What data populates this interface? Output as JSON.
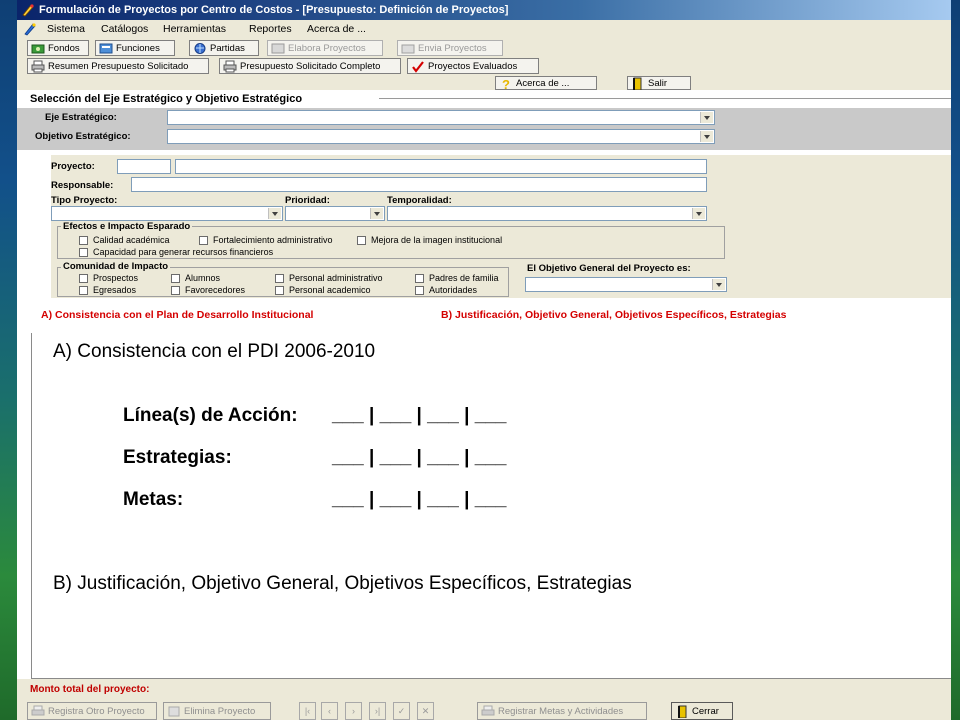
{
  "window": {
    "title": "Formulación de Proyectos por Centro de Costos - [Presupuesto: Definición de Proyectos]"
  },
  "menu": [
    "Sistema",
    "Catálogos",
    "Herramientas",
    "Reportes",
    "Acerca de ..."
  ],
  "toolbar": {
    "row1": [
      {
        "label": "Fondos",
        "icon": "fondos-icon",
        "enabled": true
      },
      {
        "label": "Funciones",
        "icon": "funciones-icon",
        "enabled": true
      },
      {
        "label": "Partidas",
        "icon": "partidas-icon",
        "enabled": true
      },
      {
        "label": "Elabora Proyectos",
        "icon": "elabora-icon",
        "enabled": false
      },
      {
        "label": "Envia Proyectos",
        "icon": "envia-icon",
        "enabled": false
      }
    ],
    "row2": [
      {
        "label": "Resumen Presupuesto Solicitado",
        "icon": "printer-icon",
        "enabled": true
      },
      {
        "label": "Presupuesto Solicitado Completo",
        "icon": "printer-icon",
        "enabled": true
      },
      {
        "label": "Proyectos Evaluados",
        "icon": "checkmark-icon",
        "enabled": true
      }
    ],
    "row3": [
      {
        "label": "Acerca de ...",
        "icon": "help-icon"
      },
      {
        "label": "Salir",
        "icon": "exit-door-icon"
      }
    ]
  },
  "selection": {
    "title": "Selección del Eje Estratégico y Objetivo Estratégico",
    "eje_label": "Eje Estratégico:",
    "eje_value": "",
    "objetivo_label": "Objetivo Estratégico:",
    "objetivo_value": ""
  },
  "project": {
    "proyecto_label": "Proyecto:",
    "responsable_label": "Responsable:",
    "tipo_label": "Tipo Proyecto:",
    "prioridad_label": "Prioridad:",
    "temporalidad_label": "Temporalidad:",
    "efectos_title": "Efectos e Impacto Esparado",
    "efectos": [
      "Calidad académica",
      "Fortalecimiento administrativo",
      "Mejora de la imagen institucional",
      "Capacidad para generar recursos financieros"
    ],
    "comunidad_title": "Comunidad de Impacto",
    "comunidad": [
      "Prospectos",
      "Alumnos",
      "Personal administrativo",
      "Padres de familia",
      "Egresados",
      "Favorecedores",
      "Personal academico",
      "Autoridades"
    ],
    "objetivo_general_label": "El Objetivo General del Proyecto es:"
  },
  "tabs": [
    "A)     Consistencia con el Plan de Desarrollo Institucional",
    "B) Justificación, Objetivo General, Objetivos Específicos, Estrategias"
  ],
  "content": {
    "heading_a": "A)  Consistencia con el PDI 2006-2010",
    "rows": [
      {
        "label": "Línea(s) de Acción:",
        "blanks": "___ | ___ | ___ | ___"
      },
      {
        "label": "Estrategias:",
        "blanks": "___ | ___ | ___ | ___"
      },
      {
        "label": "Metas:",
        "blanks": "___ | ___ | ___ | ___"
      }
    ],
    "heading_b": "B)  Justificación, Objetivo General, Objetivos Específicos, Estrategias"
  },
  "footer": {
    "total_label": "Monto total del proyecto:",
    "buttons": [
      "Registra Otro Proyecto",
      "Elimina Proyecto",
      "Registrar Metas y Actividades",
      "Cerrar"
    ],
    "nav_icons": [
      "first-icon",
      "prev-icon",
      "next-icon",
      "last-icon",
      "save-icon",
      "delete-icon"
    ]
  }
}
